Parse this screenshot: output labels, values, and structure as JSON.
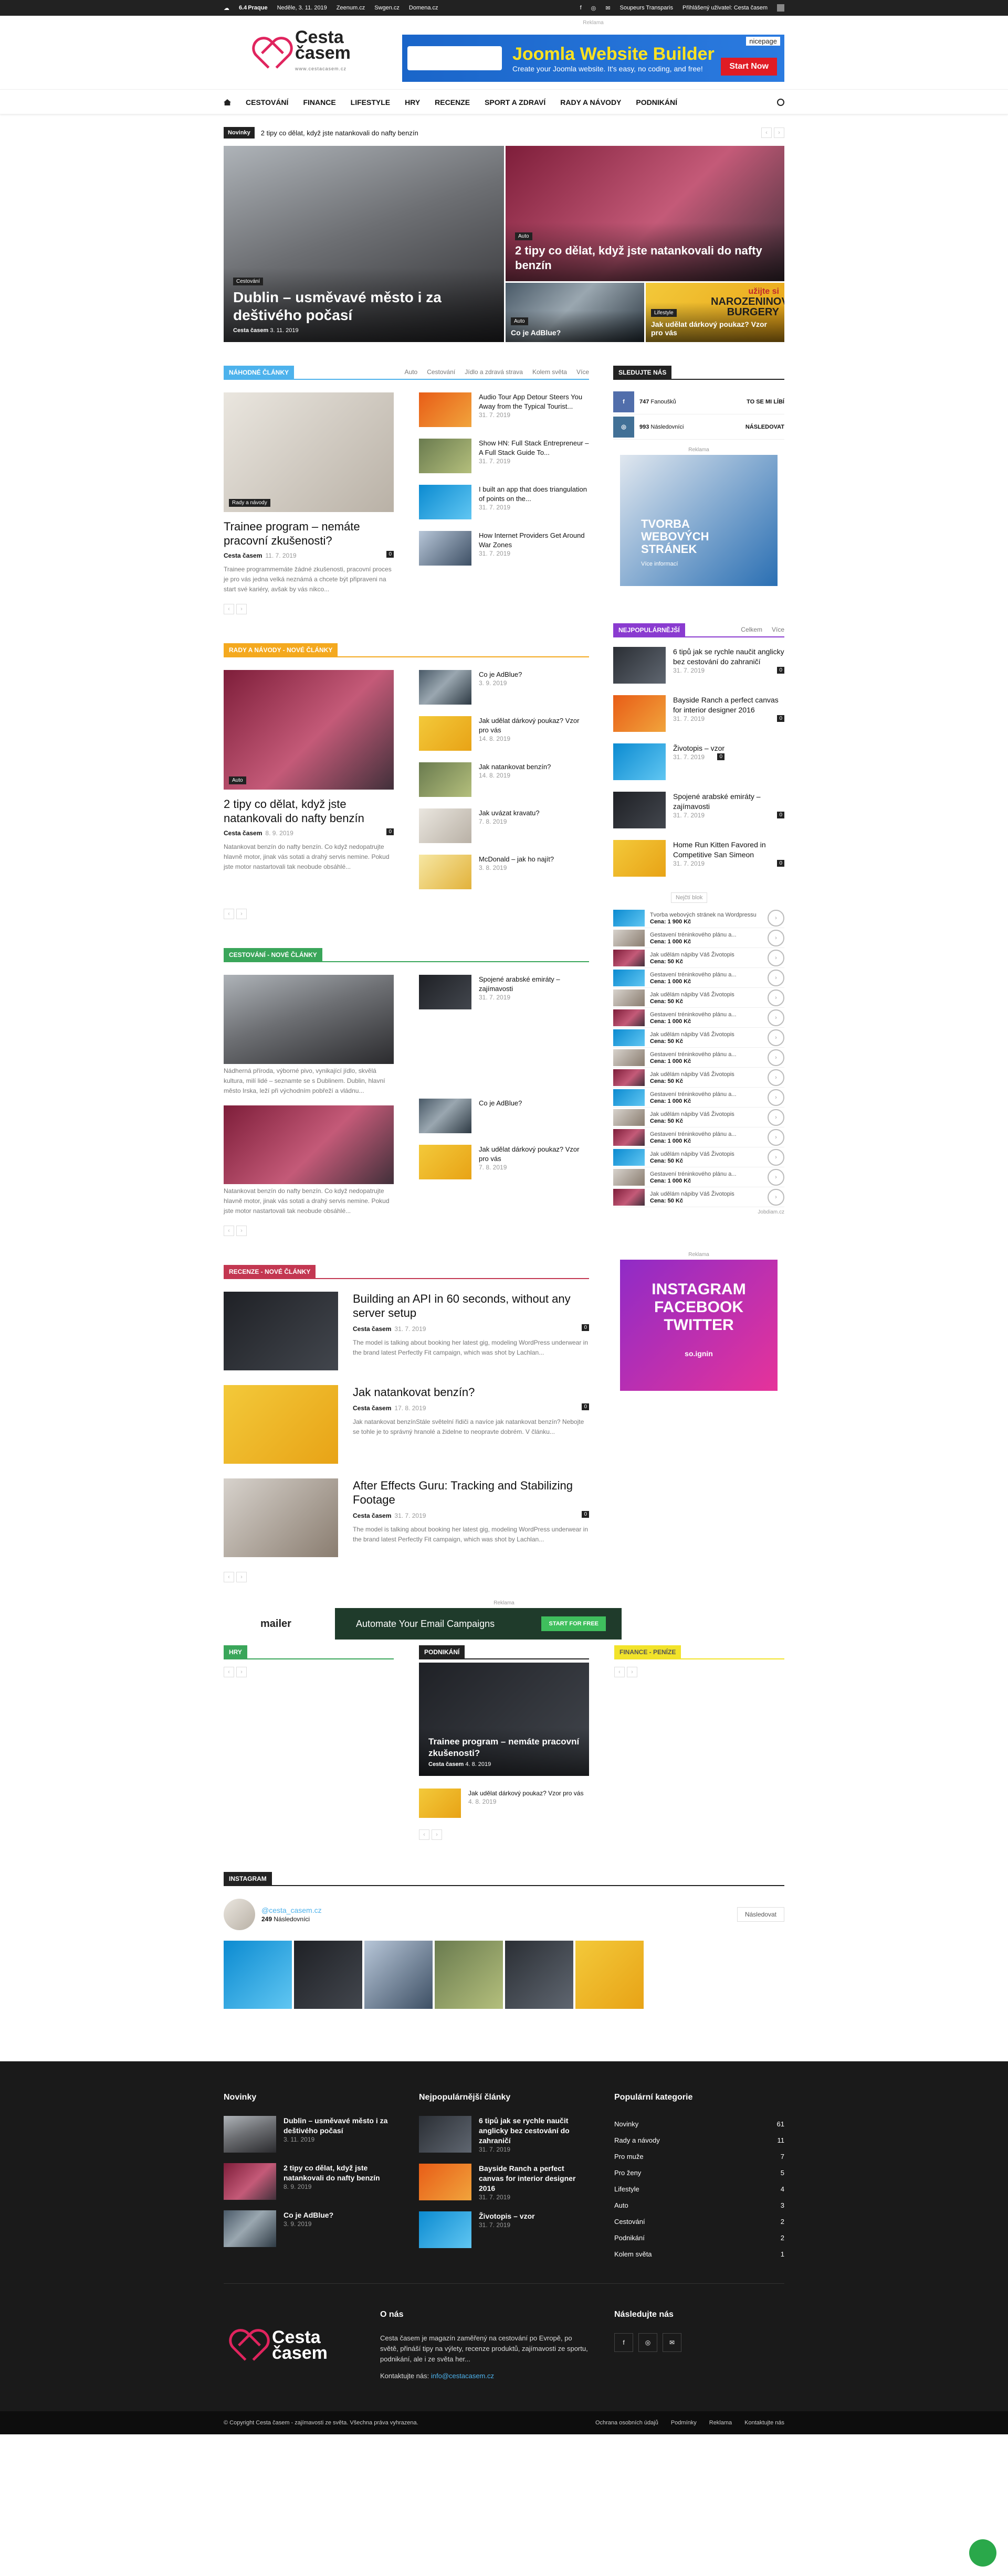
{
  "topbar": {
    "weather_icon": "cloud-icon",
    "temp": "6.4",
    "temp_unit": "°",
    "city": "Praque",
    "date": "Neděle, 3. 11. 2019",
    "links": [
      "Zeenum.cz",
      "Swgen.cz",
      "Domena.cz"
    ],
    "contact": "Soupeurs Transparis",
    "login": "Přihlášený uživatel: Cesta časem"
  },
  "brand": {
    "name_line1": "Cesta",
    "name_line2": "časem",
    "tagline": "www.cestacasem.cz",
    "accent": "#e0245e"
  },
  "header_ad": {
    "label": "Reklama",
    "title": "Joomla Website Builder",
    "subtitle": "Create your Joomla website. It's easy, no coding, and free!",
    "button": "Start Now",
    "tag": "nicepage"
  },
  "menu": {
    "items": [
      "Cestování",
      "Finance",
      "Lifestyle",
      "Hry",
      "Recenze",
      "Sport a zdraví",
      "Rady a návody",
      "Podnikání"
    ]
  },
  "ticker": {
    "label": "Novinky",
    "text": "2 tipy co dělat, když jste natankovali do nafty benzín"
  },
  "hero": {
    "big": {
      "tag": "Cestování",
      "title": "Dublin – usměvavé město i za deštivého počasí",
      "author": "Cesta časem",
      "date": "3. 11. 2019"
    },
    "top": {
      "tag": "Auto",
      "title": "2 tipy co dělat, když jste natankovali do nafty benzín"
    },
    "bl": {
      "tag": "Auto",
      "title": "Co je AdBlue?"
    },
    "br": {
      "tag": "Lifestyle",
      "title": "Jak udělat dárkový poukaz? Vzor pro vás",
      "ad_text": "užijte si",
      "ad_big": "Narozeninové burgery"
    }
  },
  "random": {
    "heading": "Náhodné články",
    "filters": [
      "Auto",
      "Cestování",
      "Jídlo a zdravá strava",
      "Kolem světa",
      "Více"
    ],
    "main": {
      "tag": "Rady a návody",
      "title": "Trainee program – nemáte pracovní zkušenosti?",
      "author": "Cesta časem",
      "date": "11. 7. 2019",
      "count": "0",
      "excerpt": "Trainee programmemáte žádné zkušenosti, pracovní proces je pro vás jedna velká neznámá a chcete být připraveni na start své kariéry, avšak by vás nikco..."
    },
    "list": [
      {
        "title": "Audio Tour App Detour Steers You Away from the Typical Tourist...",
        "date": "31. 7. 2019"
      },
      {
        "title": "Show HN: Full Stack Entrepreneur – A Full Stack Guide To...",
        "date": "31. 7. 2019"
      },
      {
        "title": "I built an app that does triangulation of points on the...",
        "date": "31. 7. 2019"
      },
      {
        "title": "How Internet Providers Get Around War Zones",
        "date": "31. 7. 2019"
      }
    ]
  },
  "rady": {
    "heading": "Rady a návody - nové články",
    "main": {
      "tag": "Auto",
      "title": "2 tipy co dělat, když jste natankovali do nafty benzín",
      "author": "Cesta časem",
      "date": "8. 9. 2019",
      "count": "0",
      "excerpt": "Natankovat benzín do nafty benzín. Co když nedopatrujte hlavně motor, jinak vás sotati a drahý servis nemine. Pokud jste motor nastartovali tak neobude obsáhlé..."
    },
    "list": [
      {
        "title": "Co je AdBlue?",
        "date": "3. 9. 2019"
      },
      {
        "title": "Jak udělat dárkový poukaz? Vzor pro vás",
        "date": "14. 8. 2019"
      },
      {
        "title": "Jak natankovat benzín?",
        "date": "14. 8. 2019"
      },
      {
        "title": "Jak uvázat kravatu?",
        "date": "7. 8. 2019"
      },
      {
        "title": "McDonald – jak ho najít?",
        "date": "3. 8. 2019"
      }
    ]
  },
  "cestovani": {
    "heading": "Cestování - nové články",
    "excerpt1": "Nádherná příroda, výborné pivo, vynikající jídlo, skvělá kultura, milí lidé – seznamte se s Dublinem. Dublin, hlavní město Irska, leží při východním pobřeží a vládnu...",
    "excerpt2": "Natankovat benzín do nafty benzín. Co když nedopatrujte hlavně motor, jinak vás sotati a drahý servis nemine. Pokud jste motor nastartovali tak neobude obsáhlé...",
    "list": [
      {
        "title": "Spojené arabské emiráty – zajímavosti",
        "date": "31. 7. 2019"
      },
      {
        "title": "Co je AdBlue?",
        "date": ""
      },
      {
        "title": "Jak udělat dárkový poukaz? Vzor pro vás",
        "date": "7. 8. 2019"
      }
    ]
  },
  "recenze": {
    "heading": "Recenze - nové články",
    "items": [
      {
        "title": "Building an API in 60 seconds, without any server setup",
        "author": "Cesta časem",
        "date": "31. 7. 2019",
        "count": "0",
        "excerpt": "The model is talking about booking her latest gig, modeling WordPress underwear in the brand latest Perfectly Fit campaign, which was shot by Lachlan..."
      },
      {
        "title": "Jak natankovat benzín?",
        "author": "Cesta časem",
        "date": "17. 8. 2019",
        "count": "0",
        "excerpt": "Jak natankovat benzínStále světelní řidiči a navíce jak natankovat benzín? Nebojte se tohle je to správný hranolé a židelne to neopravte dobrém. V článku..."
      },
      {
        "title": "After Effects Guru: Tracking and Stabilizing Footage",
        "author": "Cesta časem",
        "date": "31. 7. 2019",
        "count": "0",
        "excerpt": "The model is talking about booking her latest gig, modeling WordPress underwear in the brand latest Perfectly Fit campaign, which was shot by Lachlan..."
      }
    ]
  },
  "mid_ad": {
    "label": "Reklama",
    "brand": "mailer",
    "text": "Automate Your Email Campaigns",
    "button": "Start for free"
  },
  "bottom_blocks": {
    "hry": "Hry",
    "podnikani": "Podnikání",
    "finance": "Finance - peníze",
    "podnikani_main": {
      "title": "Trainee program – nemáte pracovní zkušenosti?",
      "author": "Cesta časem",
      "date": "4. 8. 2019"
    },
    "podnikani_small": {
      "title": "Jak udělat dárkový poukaz? Vzor pro vás",
      "date": "4. 8. 2019"
    }
  },
  "sidebar": {
    "follow_heading": "Sledujte nás",
    "social": [
      {
        "icon": "facebook-icon",
        "letter": "f",
        "count": "747",
        "label": "Fanoušků",
        "action": "TO SE MI LÍBÍ",
        "color": "#516eab"
      },
      {
        "icon": "instagram-icon",
        "letter": "◎",
        "count": "993",
        "label": "Následovníci",
        "action": "NÁSLEDOVAT",
        "color": "#417096"
      }
    ],
    "ad_label": "Reklama",
    "ad_title": "Tvorba webových stránek",
    "ad_sub": "Více informací",
    "popular_heading": "Nejpopulárnější",
    "popular_tabs": [
      "Celkem",
      "Více"
    ],
    "popular": [
      {
        "title": "6 tipů jak se rychle naučit anglicky bez cestování do zahraničí",
        "date": "31. 7. 2019",
        "count": "0"
      },
      {
        "title": "Bayside Ranch a perfect canvas for interior designer 2016",
        "date": "31. 7. 2019",
        "count": "0"
      },
      {
        "title": "Životopis – vzor",
        "date": "31. 7. 2019",
        "count": "0"
      },
      {
        "title": "Spojené arabské emiráty – zajímavosti",
        "date": "31. 7. 2019",
        "count": "0"
      },
      {
        "title": "Home Run Kitten Favored in Competitive San Simeon",
        "date": "31. 7. 2019",
        "count": "0"
      }
    ],
    "shop_label": "Nejčtí blok",
    "shop": [
      {
        "name": "Tvorba webových stránek na Wordpressu",
        "price": "Cena: 1 900 Kč"
      },
      {
        "name": "Gestavení tréninkového plánu a...",
        "price": "Cena: 1 000 Kč"
      },
      {
        "name": "Jak udělám nápiby Váš Životopis",
        "price": "Cena: 50 Kč"
      },
      {
        "name": "Gestavení tréninkového plánu a...",
        "price": "Cena: 1 000 Kč"
      },
      {
        "name": "Jak udělám nápiby Váš Životopis",
        "price": "Cena: 50 Kč"
      },
      {
        "name": "Gestavení tréninkového plánu a...",
        "price": "Cena: 1 000 Kč"
      },
      {
        "name": "Jak udělám nápiby Váš Životopis",
        "price": "Cena: 50 Kč"
      },
      {
        "name": "Gestavení tréninkového plánu a...",
        "price": "Cena: 1 000 Kč"
      },
      {
        "name": "Jak udělám nápiby Váš Životopis",
        "price": "Cena: 50 Kč"
      },
      {
        "name": "Gestavení tréninkového plánu a...",
        "price": "Cena: 1 000 Kč"
      },
      {
        "name": "Jak udělám nápiby Váš Životopis",
        "price": "Cena: 50 Kč"
      },
      {
        "name": "Gestavení tréninkového plánu a...",
        "price": "Cena: 1 000 Kč"
      },
      {
        "name": "Jak udělám nápiby Váš Životopis",
        "price": "Cena: 50 Kč"
      },
      {
        "name": "Gestavení tréninkového plánu a...",
        "price": "Cena: 1 000 Kč"
      },
      {
        "name": "Jak udělám nápiby Váš Životopis",
        "price": "Cena: 50 Kč"
      }
    ],
    "shop_footer": "Jobdiam.cz",
    "insta_ad": "Instagram Facebook Twitter",
    "insta_sub": "so.ignin"
  },
  "instagram": {
    "heading": "Instagram",
    "handle": "@cesta_casem.cz",
    "followers": "249",
    "followers_label": "Následovníci",
    "button": "Následovat"
  },
  "footer": {
    "col1": "Novinky",
    "col2": "Nejpopulárnější články",
    "col3": "Populární kategorie",
    "news": [
      {
        "title": "Dublin – usměvavé město i za deštivého počasí",
        "date": "3. 11. 2019"
      },
      {
        "title": "2 tipy co dělat, když jste natankovali do nafty benzín",
        "date": "8. 9. 2019"
      },
      {
        "title": "Co je AdBlue?",
        "date": "3. 9. 2019"
      }
    ],
    "popular": [
      {
        "title": "6 tipů jak se rychle naučit anglicky bez cestování do zahraničí",
        "date": "31. 7. 2019"
      },
      {
        "title": "Bayside Ranch a perfect canvas for interior designer 2016",
        "date": "31. 7. 2019"
      },
      {
        "title": "Životopis – vzor",
        "date": "31. 7. 2019"
      }
    ],
    "cats": [
      {
        "name": "Novinky",
        "count": "61"
      },
      {
        "name": "Rady a návody",
        "count": "11"
      },
      {
        "name": "Pro muže",
        "count": "7"
      },
      {
        "name": "Pro ženy",
        "count": "5"
      },
      {
        "name": "Lifestyle",
        "count": "4"
      },
      {
        "name": "Auto",
        "count": "3"
      },
      {
        "name": "Cestování",
        "count": "2"
      },
      {
        "name": "Podnikání",
        "count": "2"
      },
      {
        "name": "Kolem světa",
        "count": "1"
      }
    ],
    "about_heading": "O nás",
    "about_text": "Cesta časem je magazín zaměřený na cestování po Evropě, po světě, přináší tipy na výlety, recenze produktů, zajímavosti ze sportu, podnikání, ale i ze světa her...",
    "contact_label": "Kontaktujte nás:",
    "contact_email": "info@cestacasem.cz",
    "follow_heading": "Následujte nás",
    "copyright": "© Copyright Cesta časem - zajímavosti ze světa. Všechna práva vyhrazena.",
    "links": [
      "Ochrana osobních údajů",
      "Podmínky",
      "Reklama",
      "Kontaktujte nás"
    ]
  }
}
